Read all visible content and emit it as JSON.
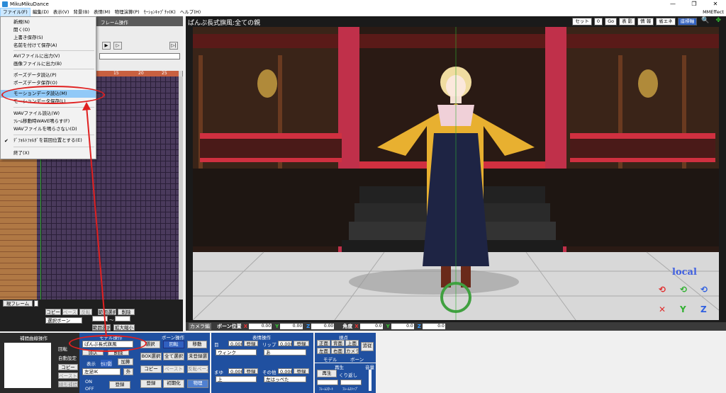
{
  "window": {
    "title": "MikuMikuDance",
    "min": "—",
    "max": "❐",
    "close": "✕"
  },
  "menubar": {
    "items": [
      "ファイル(F)",
      "編集(D)",
      "表示(V)",
      "背景(B)",
      "表情(M)",
      "物理演算(P)",
      "ﾓｰｼｮﾝｷｬﾌﾟﾁｬ(K)",
      "ヘルプ(H)"
    ],
    "right": "MMEffect"
  },
  "file_menu": {
    "items": [
      {
        "label": "新規(N)"
      },
      {
        "label": "開く(O)"
      },
      {
        "label": "上書き保存(S)"
      },
      {
        "label": "名前を付けて保存(A)"
      },
      {
        "label": "AVIファイルに出力(V)"
      },
      {
        "label": "画像ファイルに出力(B)"
      },
      {
        "label": "ポーズデータ読込(P)"
      },
      {
        "label": "ポーズデータ保存(O)"
      },
      {
        "label": "モーションデータ読込(M)"
      },
      {
        "label": "モーションデータ保存(L)"
      },
      {
        "label": "WAVファイル読込(W)"
      },
      {
        "label": "ﾌﾚｰﾑ移動時WAVE鳴らす(F)"
      },
      {
        "label": "WAVファイルを鳴らさない(D)"
      },
      {
        "label": "ﾃﾞﾌｫﾙﾄﾌｫﾙﾀﾞを前回位置とする(E)"
      },
      {
        "label": "終了(X)"
      }
    ]
  },
  "left": {
    "frame_op_title": "フレーム操作",
    "ruler": [
      "15",
      "20",
      "25"
    ],
    "current_frame_label": "現フレーム",
    "copy": "コピー",
    "paste": "ペースト",
    "invert": "反転",
    "range_select": "範囲選択",
    "delete": "削除",
    "select_bone": "選択ボーン",
    "range_sel2": "範囲選択",
    "zoom": "拡大縮小",
    "tilde": "〜"
  },
  "interp": {
    "title": "補間曲線操作",
    "rotate": "回転",
    "auto": "自動設定",
    "copy": "コピー",
    "paste": "ペースト",
    "linear": "線形補間"
  },
  "model": {
    "title": "モデル操作",
    "selected": "ぱんぷ長式旗風",
    "display": "表示",
    "shadow": "ｾﾙﾌ影",
    "add": "加算",
    "ik": "左足IK",
    "ext": "外",
    "on": "ON",
    "off": "OFF",
    "register": "登録",
    "load": "読込",
    "delete": "削除"
  },
  "bone": {
    "title": "ボーン操作",
    "select": "選択",
    "rotate": "回転",
    "move": "移動",
    "box": "BOX選択",
    "all": "全て選択",
    "unreg": "未登録選",
    "copy": "コピー",
    "paste": "ペースト",
    "invpaste": "反転ペースト",
    "register": "登録",
    "init": "初期化",
    "physics": "物理"
  },
  "face": {
    "title": "表情操作",
    "eye": "目",
    "lip": "リップ",
    "brow": "まゆ",
    "other": "その他",
    "val": "0.000",
    "reg": "登録",
    "eye_sel": "ウィンク",
    "lip_sel": "あ",
    "brow_sel": "上",
    "other_sel": "左はっぺた"
  },
  "view": {
    "title": "視点",
    "front": "正面",
    "back": "背面",
    "top": "上面",
    "left": "左面",
    "right": "右面",
    "camera": "カメラ",
    "follow": "追従",
    "model": "モデル",
    "bone": "ボーン"
  },
  "play": {
    "title": "再生",
    "play": "再生",
    "repeat": "くり返し",
    "fstart": "ﾌﾚｰﾑｽﾀｰﾄ",
    "fstop": "ﾌﾚｰﾑｽﾄｯﾌﾟ",
    "vol": "音量"
  },
  "viewport": {
    "title": "ぱんぷ長式旗風:全ての親",
    "btns": [
      "セット",
      "0",
      "Go",
      "表 影",
      "情 報",
      "省エネ",
      "座標軸"
    ],
    "local": "local"
  },
  "status": {
    "cam": "カメラ編",
    "bone_pos": "ボーン位置",
    "angle": "角度",
    "vals": [
      "0.00",
      "0.00",
      "0.00",
      "0.0",
      "0.0",
      "0.0"
    ]
  },
  "colors": {
    "accent": "#3060c0",
    "highlight": "#91c9f7",
    "annot": "#e02020"
  }
}
